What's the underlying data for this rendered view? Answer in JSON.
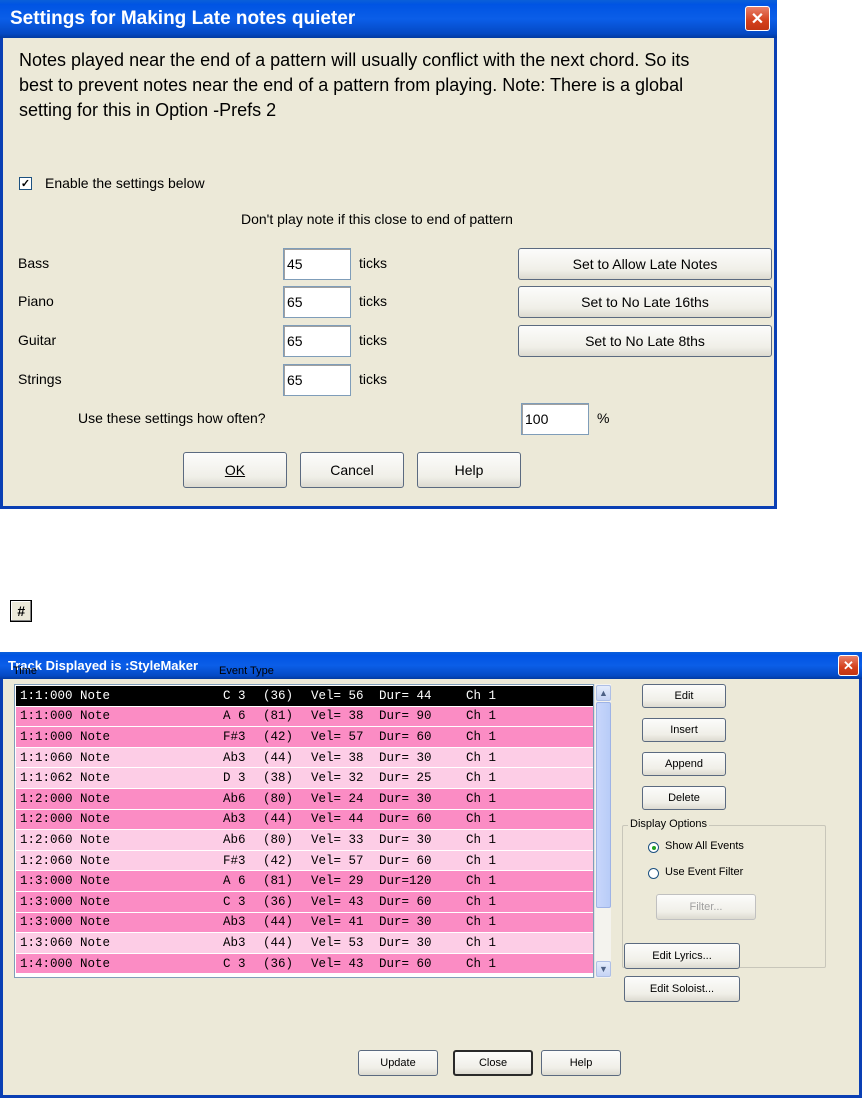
{
  "dialog1": {
    "title": "Settings for Making Late notes quieter",
    "description_lines": [
      "Notes played near the end of a pattern will usually conflict with the next chord. So its",
      "best to prevent notes near the end of a pattern from playing. Note: There is a global",
      "setting for this in Option -Prefs 2"
    ],
    "enable_label": "Enable the settings below",
    "enable_checked": true,
    "heading": "Don't play note if this close to end of pattern",
    "rows": [
      {
        "label": "Bass",
        "value": "45",
        "unit": "ticks"
      },
      {
        "label": "Piano",
        "value": "65",
        "unit": "ticks"
      },
      {
        "label": "Guitar",
        "value": "65",
        "unit": "ticks"
      },
      {
        "label": "Strings",
        "value": "65",
        "unit": "ticks"
      }
    ],
    "preset_buttons": [
      "Set to Allow Late Notes",
      "Set to No Late 16ths",
      "Set to No Late 8ths"
    ],
    "often_label": "Use these settings how often?",
    "often_value": "100",
    "often_unit": "%",
    "buttons": {
      "ok": "OK",
      "cancel": "Cancel",
      "help": "Help"
    }
  },
  "hash_icon_glyph": "#",
  "dialog2": {
    "title": "Track Displayed is :StyleMaker",
    "col_time": "Time",
    "col_event": "Event Type",
    "events": [
      {
        "time": "1:1:000 Note",
        "note": "C 3",
        "num": "(36)",
        "vel": "Vel= 56",
        "dur": "Dur= 44",
        "ch": "Ch 1",
        "shade": "selected"
      },
      {
        "time": "1:1:000 Note",
        "note": "A 6",
        "num": "(81)",
        "vel": "Vel= 38",
        "dur": "Dur= 90",
        "ch": "Ch 1",
        "shade": "dark"
      },
      {
        "time": "1:1:000 Note",
        "note": "F#3",
        "num": "(42)",
        "vel": "Vel= 57",
        "dur": "Dur= 60",
        "ch": "Ch 1",
        "shade": "dark"
      },
      {
        "time": "1:1:060 Note",
        "note": "Ab3",
        "num": "(44)",
        "vel": "Vel= 38",
        "dur": "Dur= 30",
        "ch": "Ch 1",
        "shade": "light"
      },
      {
        "time": "1:1:062 Note",
        "note": "D 3",
        "num": "(38)",
        "vel": "Vel= 32",
        "dur": "Dur= 25",
        "ch": "Ch 1",
        "shade": "light"
      },
      {
        "time": "1:2:000 Note",
        "note": "Ab6",
        "num": "(80)",
        "vel": "Vel= 24",
        "dur": "Dur= 30",
        "ch": "Ch 1",
        "shade": "dark"
      },
      {
        "time": "1:2:000 Note",
        "note": "Ab3",
        "num": "(44)",
        "vel": "Vel= 44",
        "dur": "Dur= 60",
        "ch": "Ch 1",
        "shade": "dark"
      },
      {
        "time": "1:2:060 Note",
        "note": "Ab6",
        "num": "(80)",
        "vel": "Vel= 33",
        "dur": "Dur= 30",
        "ch": "Ch 1",
        "shade": "light"
      },
      {
        "time": "1:2:060 Note",
        "note": "F#3",
        "num": "(42)",
        "vel": "Vel= 57",
        "dur": "Dur= 60",
        "ch": "Ch 1",
        "shade": "light"
      },
      {
        "time": "1:3:000 Note",
        "note": "A 6",
        "num": "(81)",
        "vel": "Vel= 29",
        "dur": "Dur=120",
        "ch": "Ch 1",
        "shade": "dark"
      },
      {
        "time": "1:3:000 Note",
        "note": "C 3",
        "num": "(36)",
        "vel": "Vel= 43",
        "dur": "Dur= 60",
        "ch": "Ch 1",
        "shade": "dark"
      },
      {
        "time": "1:3:000 Note",
        "note": "Ab3",
        "num": "(44)",
        "vel": "Vel= 41",
        "dur": "Dur= 30",
        "ch": "Ch 1",
        "shade": "dark"
      },
      {
        "time": "1:3:060 Note",
        "note": "Ab3",
        "num": "(44)",
        "vel": "Vel= 53",
        "dur": "Dur= 30",
        "ch": "Ch 1",
        "shade": "light"
      },
      {
        "time": "1:4:000 Note",
        "note": "C 3",
        "num": "(36)",
        "vel": "Vel= 43",
        "dur": "Dur= 60",
        "ch": "Ch 1",
        "shade": "dark"
      }
    ],
    "side_buttons": {
      "edit": "Edit",
      "insert": "Insert",
      "append": "Append",
      "delete": "Delete"
    },
    "display_options": {
      "legend": "Display Options",
      "show_all": "Show All Events",
      "use_filter": "Use Event Filter",
      "selected": "show_all",
      "filter_button": "Filter..."
    },
    "edit_lyrics": "Edit Lyrics...",
    "edit_soloist": "Edit Soloist...",
    "bottom_buttons": {
      "update": "Update",
      "close": "Close",
      "help": "Help"
    }
  },
  "colors": {
    "row_dark": "#fb8cc4",
    "row_light": "#fdcde6",
    "row_selected": "#000000",
    "dialog_bg": "#ece9d8",
    "title_blue": "#0054e3"
  }
}
